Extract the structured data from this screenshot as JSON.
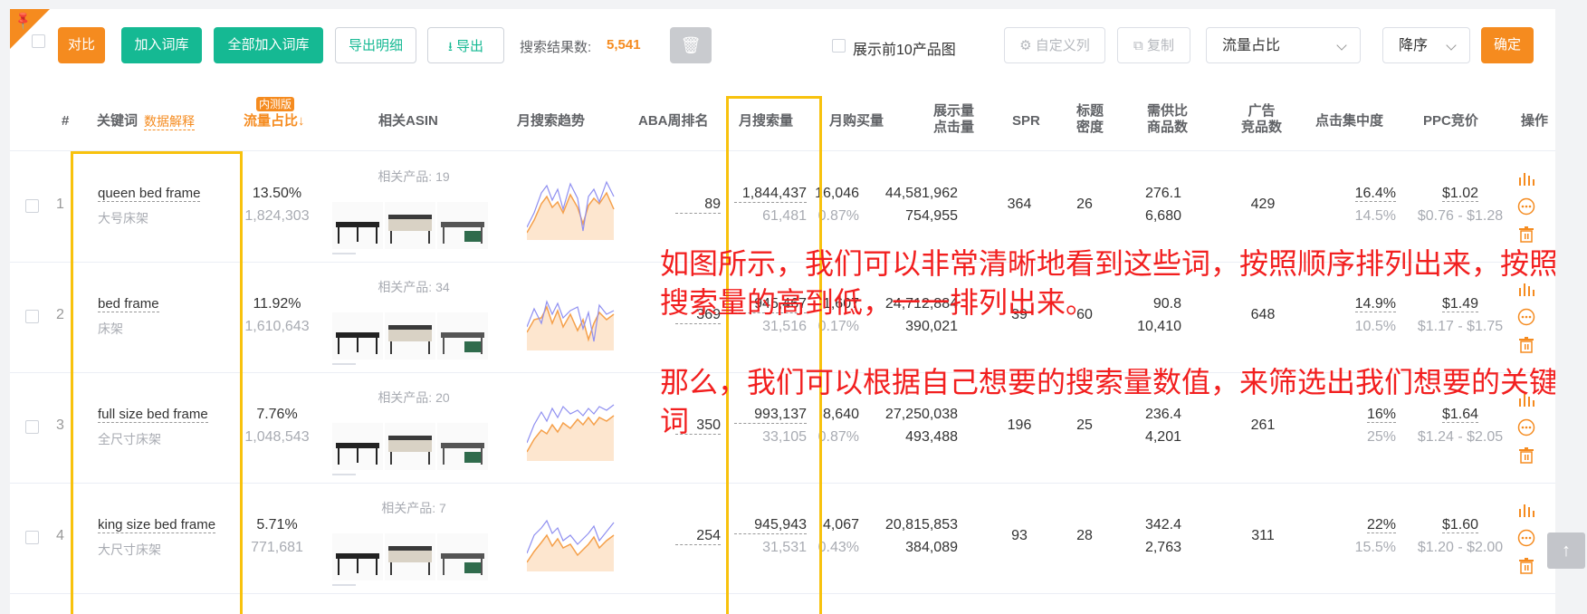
{
  "toolbar": {
    "compare": "对比",
    "add_to_lexicon": "加入词库",
    "add_all_to_lexicon": "全部加入词库",
    "export_detail": "导出明细",
    "export": "导出",
    "result_label": "搜索结果数:",
    "result_count": "5,541",
    "show_top10": "展示前10产品图",
    "custom_columns": "自定义列",
    "copy": "复制",
    "sort_field": "流量占比",
    "sort_order": "降序",
    "confirm": "确定"
  },
  "columns": {
    "index": "#",
    "keyword": "关键词",
    "data_explain": "数据解释",
    "beta_badge": "内测版",
    "traffic_share": "流量占比↓",
    "asin": "相关ASIN",
    "trend": "月搜索趋势",
    "aba_rank": "ABA周排名",
    "monthly_search": "月搜索量",
    "monthly_purchase": "月购买量",
    "impressions_l1": "展示量",
    "impressions_l2": "点击量",
    "spr": "SPR",
    "title_density_l1": "标题",
    "title_density_l2": "密度",
    "supply_ratio_l1": "需供比",
    "supply_ratio_l2": "商品数",
    "ad_competitors_l1": "广告",
    "ad_competitors_l2": "竞品数",
    "click_concentration": "点击集中度",
    "ppc": "PPC竞价",
    "actions": "操作"
  },
  "rows": [
    {
      "index": "1",
      "keyword": "queen bed frame",
      "keyword_cn": "大号床架",
      "share": "13.50%",
      "share_sub": "1,824,303",
      "asin_label": "相关产品: 19",
      "aba": "89",
      "search": "1,844,437",
      "search_sub": "61,481",
      "purchase": "16,046",
      "purchase_rate": "0.87%",
      "impressions": "44,581,962",
      "clicks": "754,955",
      "spr": "364",
      "title_density": "26",
      "supply_ratio": "276.1",
      "products": "6,680",
      "ad_comp": "429",
      "click_conc": "16.4%",
      "click_conc_sub": "14.5%",
      "ppc": "$1.02",
      "ppc_range": "$0.76 - $1.28"
    },
    {
      "index": "2",
      "keyword": "bed frame",
      "keyword_cn": "床架",
      "share": "11.92%",
      "share_sub": "1,610,643",
      "asin_label": "相关产品: 34",
      "aba": "369",
      "search": "945,467",
      "search_sub": "31,516",
      "purchase": "1,607",
      "purchase_rate": "0.17%",
      "impressions": "24,712,884",
      "clicks": "390,021",
      "spr": "39",
      "title_density": "60",
      "supply_ratio": "90.8",
      "products": "10,410",
      "ad_comp": "648",
      "click_conc": "14.9%",
      "click_conc_sub": "10.5%",
      "ppc": "$1.49",
      "ppc_range": "$1.17 - $1.75"
    },
    {
      "index": "3",
      "keyword": "full size bed frame",
      "keyword_cn": "全尺寸床架",
      "share": "7.76%",
      "share_sub": "1,048,543",
      "asin_label": "相关产品: 20",
      "aba": "350",
      "search": "993,137",
      "search_sub": "33,105",
      "purchase": "8,640",
      "purchase_rate": "0.87%",
      "impressions": "27,250,038",
      "clicks": "493,488",
      "spr": "196",
      "title_density": "25",
      "supply_ratio": "236.4",
      "products": "4,201",
      "ad_comp": "261",
      "click_conc": "16%",
      "click_conc_sub": "25%",
      "ppc": "$1.64",
      "ppc_range": "$1.24 - $2.05"
    },
    {
      "index": "4",
      "keyword": "king size bed frame",
      "keyword_cn": "大尺寸床架",
      "share": "5.71%",
      "share_sub": "771,681",
      "asin_label": "相关产品: 7",
      "aba": "254",
      "search": "945,943",
      "search_sub": "31,531",
      "purchase": "4,067",
      "purchase_rate": "0.43%",
      "impressions": "20,815,853",
      "clicks": "384,089",
      "spr": "93",
      "title_density": "28",
      "supply_ratio": "342.4",
      "products": "2,763",
      "ad_comp": "311",
      "click_conc": "22%",
      "click_conc_sub": "15.5%",
      "ppc": "$1.60",
      "ppc_range": "$1.20 - $2.00"
    }
  ],
  "annotation": {
    "line1": "如图所示，我们可以非常清晰地看到这些词，按照顺序排列出来，按照搜索量的高到低，一一排列出来。",
    "line2": "那么，我们可以根据自己想要的搜索量数值，来筛选出我们想要的关键词"
  },
  "colors": {
    "accent": "#f58b1f",
    "green": "#15b993",
    "annotation": "#f21f1f",
    "highlight": "#f8c20d"
  }
}
